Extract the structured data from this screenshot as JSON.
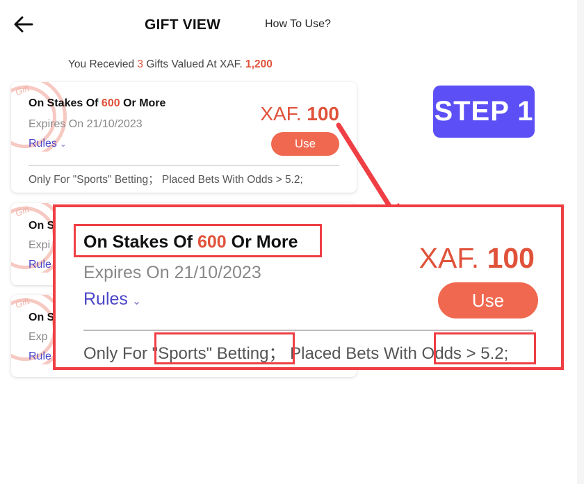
{
  "header": {
    "title": "GIFT VIEW",
    "how_to": "How To Use?"
  },
  "summary": {
    "prefix": "You Recevied ",
    "count": "3",
    "middle": " Gifts Valued At XAF. ",
    "total": "1,200"
  },
  "gift": {
    "title_prefix": "On Stakes Of ",
    "stake": "600",
    "title_suffix": " Or More",
    "expires": "Expires On 21/10/2023",
    "rules": "Rules",
    "currency": "XAF. ",
    "amount": "100",
    "use": "Use",
    "note": "Only For \"Sports\" Betting；  Placed Bets With Odds > 5.2;"
  },
  "partial_cards": [
    {
      "title": "On S",
      "expires": "Expi",
      "rules": "Rule"
    },
    {
      "title": "On S",
      "expires": "Exp",
      "rules": "Rule"
    }
  ],
  "watermark": "Gift",
  "step_badge": "STEP 1",
  "colors": {
    "accent": "#e0523a",
    "button": "#f0684f",
    "rules": "#4a45c8",
    "step_bg": "#5b4ff5",
    "highlight": "#ef3f44"
  }
}
